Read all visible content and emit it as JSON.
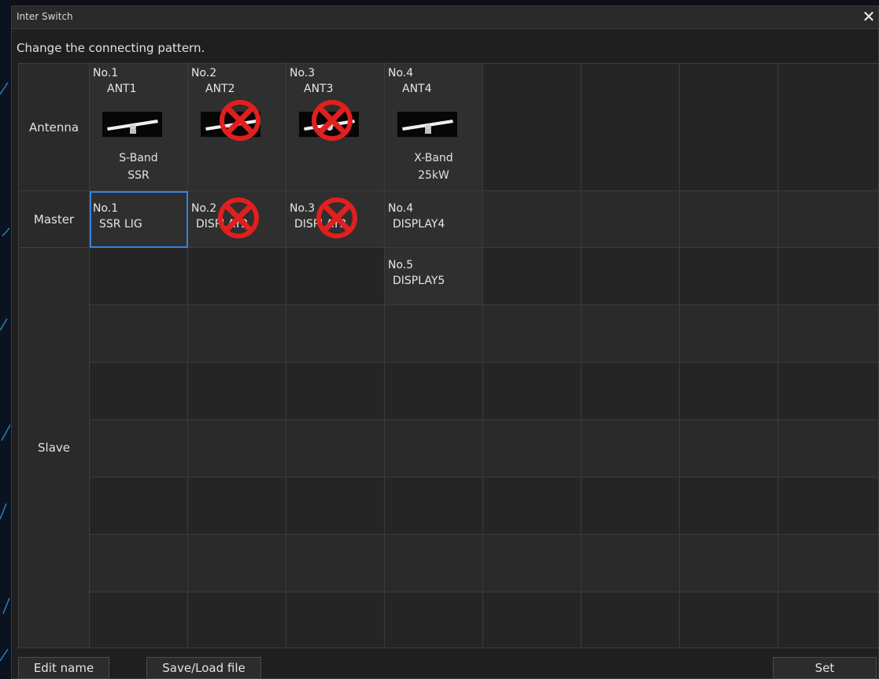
{
  "window": {
    "title": "Inter Switch",
    "close_label": "✕"
  },
  "instruction": "Change the connecting pattern.",
  "rows": {
    "antenna": "Antenna",
    "master": "Master",
    "slave": "Slave"
  },
  "antennas": [
    {
      "no": "No.1",
      "name": "ANT1",
      "band": "S-Band",
      "detail": "SSR",
      "disabled": false
    },
    {
      "no": "No.2",
      "name": "ANT2",
      "band": "",
      "detail": "",
      "disabled": true
    },
    {
      "no": "No.3",
      "name": "ANT3",
      "band": "",
      "detail": "",
      "disabled": true
    },
    {
      "no": "No.4",
      "name": "ANT4",
      "band": "X-Band",
      "detail": "25kW",
      "disabled": false
    }
  ],
  "masters": [
    {
      "no": "No.1",
      "name": "SSR LIG",
      "selected": true,
      "disabled": false
    },
    {
      "no": "No.2",
      "name": "DISPLAY2",
      "selected": false,
      "disabled": true
    },
    {
      "no": "No.3",
      "name": "DISPLAY3",
      "selected": false,
      "disabled": true
    },
    {
      "no": "No.4",
      "name": "DISPLAY4",
      "selected": false,
      "disabled": false
    }
  ],
  "slaves": [
    {
      "no": "No.5",
      "name": "DISPLAY5"
    }
  ],
  "buttons": {
    "edit_name": "Edit name",
    "save_load": "Save/Load file",
    "set": "Set"
  },
  "colors": {
    "selection": "#3b82d8",
    "disabled_mark": "#e01f1f"
  },
  "icons": {
    "antenna": "radar-antenna-icon",
    "disabled": "disabled-cross-icon",
    "close": "close-icon"
  }
}
